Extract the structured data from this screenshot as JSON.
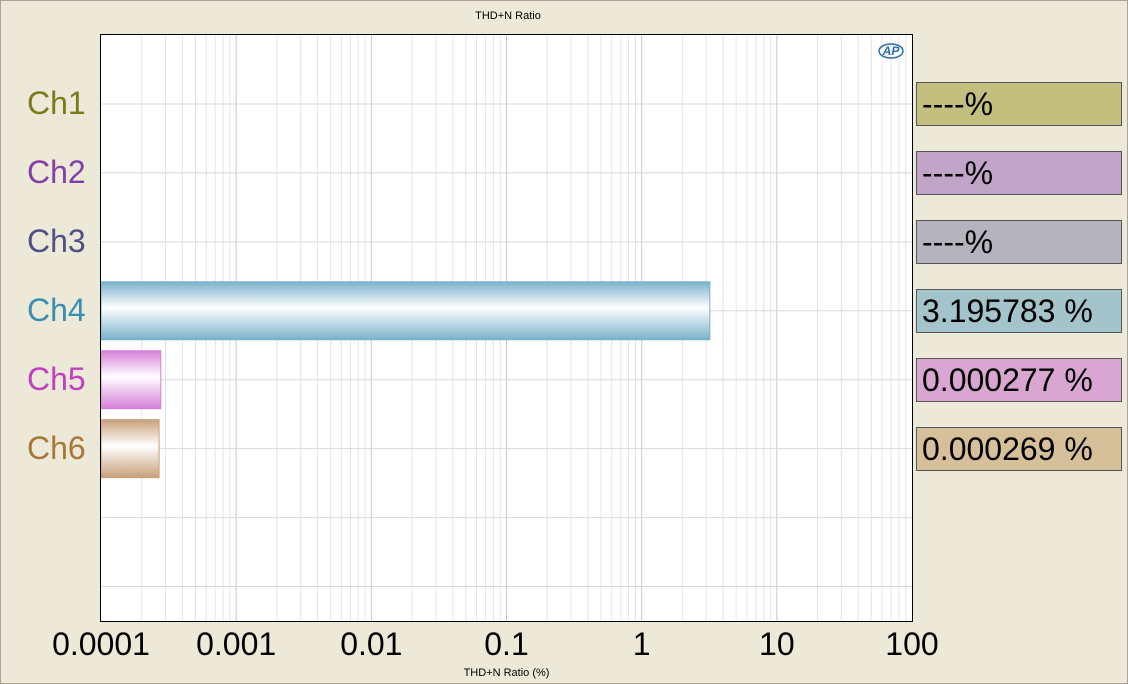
{
  "chart_data": {
    "type": "bar",
    "orientation": "horizontal",
    "title": "THD+N Ratio",
    "xlabel": "THD+N Ratio (%)",
    "xscale": "log",
    "xlim": [
      0.0001,
      100
    ],
    "x_tick_labels": [
      "0.0001",
      "0.001",
      "0.01",
      "0.1",
      "1",
      "10",
      "100"
    ],
    "grid": true,
    "categories": [
      "Ch1",
      "Ch2",
      "Ch3",
      "Ch4",
      "Ch5",
      "Ch6"
    ],
    "values": [
      null,
      null,
      null,
      3.195783,
      0.000277,
      0.000269
    ],
    "value_labels": [
      "----%",
      "----%",
      "----%",
      "3.195783 %",
      "0.000277 %",
      "0.000269 %"
    ],
    "label_colors": [
      "#7b7b18",
      "#8040a8",
      "#505088",
      "#3a8fb0",
      "#c040c0",
      "#a87838"
    ],
    "box_colors": [
      "#c3c07f",
      "#c0a5c8",
      "#b5b3bc",
      "#a2c4ca",
      "#d8a6d0",
      "#d5c09a"
    ],
    "bar_colors": [
      "#b0b060",
      "#a080c0",
      "#9090b0",
      "#7ab2cc",
      "#d680d8",
      "#c8a07a"
    ]
  },
  "logo": {
    "text": "AP"
  }
}
